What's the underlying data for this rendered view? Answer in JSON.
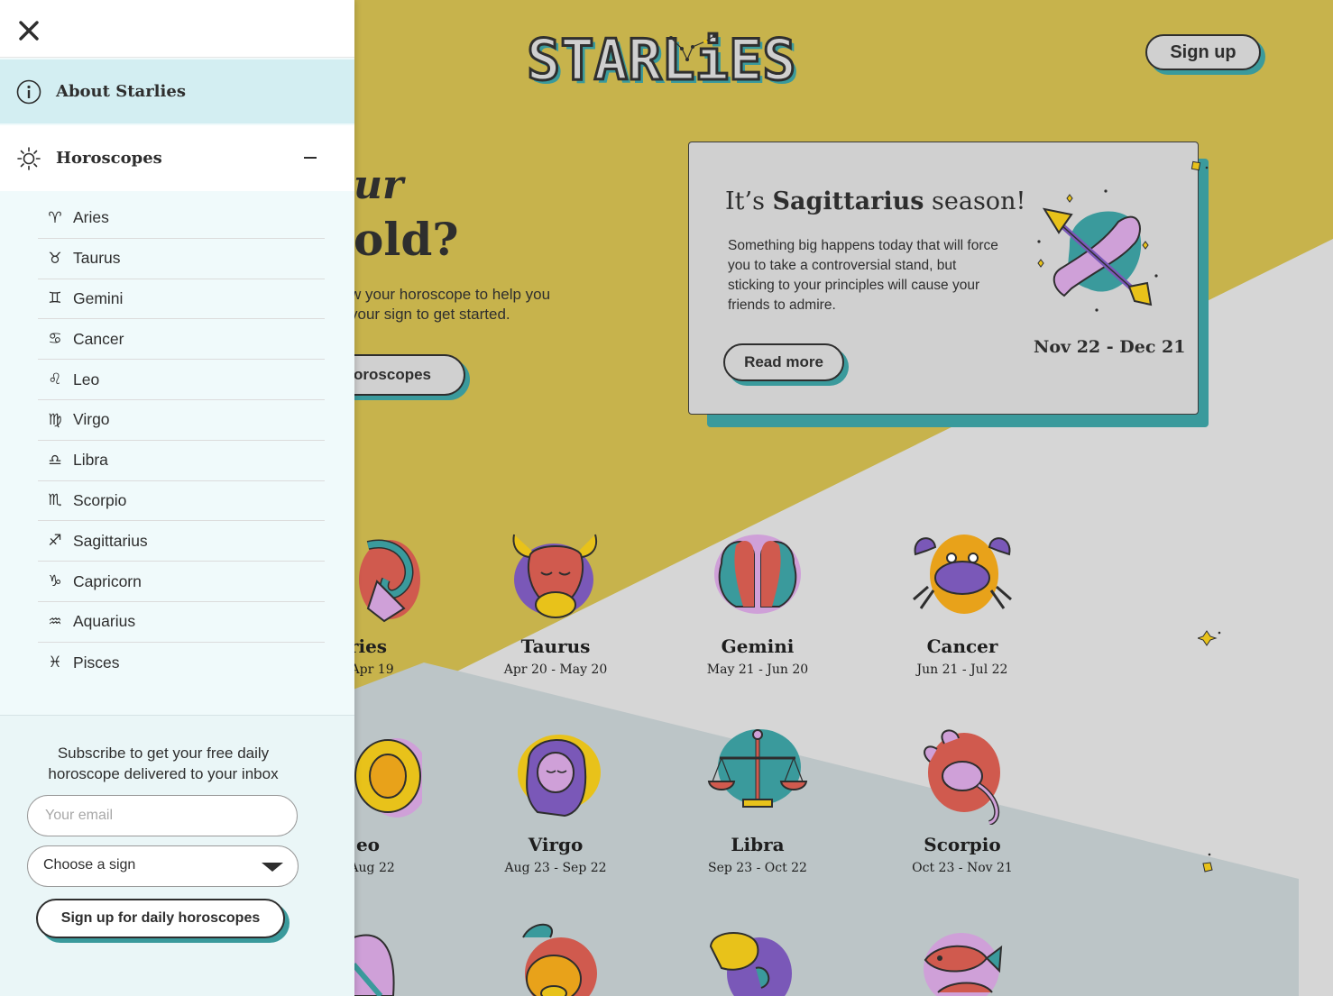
{
  "brand": {
    "logo_text": "STARLiES"
  },
  "header": {
    "signup_label": "Sign up"
  },
  "hero": {
    "title_line1": "ur",
    "title_line2": "old?",
    "subtitle": "w your horoscope to help you your sign to get started.",
    "button_label": "horoscopes"
  },
  "season_card": {
    "prefix": "It’s ",
    "sign": "Sagittarius",
    "suffix": " season!",
    "body": "Something big happens today that will force you to take a controversial stand, but sticking to your principles will cause your friends to admire.",
    "button_label": "Read more",
    "dates": "Nov 22 - Dec 21"
  },
  "grid": [
    {
      "name": "ries",
      "range": "- Apr 19"
    },
    {
      "name": "Taurus",
      "range": "Apr 20 - May 20"
    },
    {
      "name": "Gemini",
      "range": "May 21 - Jun 20"
    },
    {
      "name": "Cancer",
      "range": "Jun 21 - Jul 22"
    },
    {
      "name": "eo",
      "range": "- Aug 22"
    },
    {
      "name": "Virgo",
      "range": "Aug 23 - Sep 22"
    },
    {
      "name": "Libra",
      "range": "Sep 23 - Oct 22"
    },
    {
      "name": "Scorpio",
      "range": "Oct 23 - Nov 21"
    }
  ],
  "sidebar": {
    "about_label": "About Starlies",
    "horoscopes_label": "Horoscopes",
    "signs": [
      {
        "glyph": "♈",
        "label": "Aries"
      },
      {
        "glyph": "♉",
        "label": "Taurus"
      },
      {
        "glyph": "♊",
        "label": "Gemini"
      },
      {
        "glyph": "♋",
        "label": "Cancer"
      },
      {
        "glyph": "♌",
        "label": "Leo"
      },
      {
        "glyph": "♍",
        "label": "Virgo"
      },
      {
        "glyph": "♎",
        "label": "Libra"
      },
      {
        "glyph": "♏",
        "label": "Scorpio"
      },
      {
        "glyph": "♐",
        "label": "Sagittarius"
      },
      {
        "glyph": "♑",
        "label": "Capricorn"
      },
      {
        "glyph": "♒",
        "label": "Aquarius"
      },
      {
        "glyph": "♓",
        "label": "Pisces"
      }
    ],
    "subscribe": {
      "text": "Subscribe to get your free daily horoscope delivered to your inbox",
      "email_placeholder": "Your email",
      "select_value": "Choose a sign",
      "button_label": "Sign up for daily horoscopes"
    }
  },
  "colors": {
    "mustard": "#c7b34c",
    "teal": "#3a9a9c",
    "light_gray": "#d6d6d6",
    "blue_gray": "#bcc5c7",
    "sidebar_bg": "#f0fafb",
    "about_bg": "#d3eef2"
  },
  "icons": {
    "close": "close-icon",
    "about": "info-icon",
    "horoscopes": "sun-icon",
    "collapse": "minus-icon",
    "select": "caret-down-icon"
  }
}
